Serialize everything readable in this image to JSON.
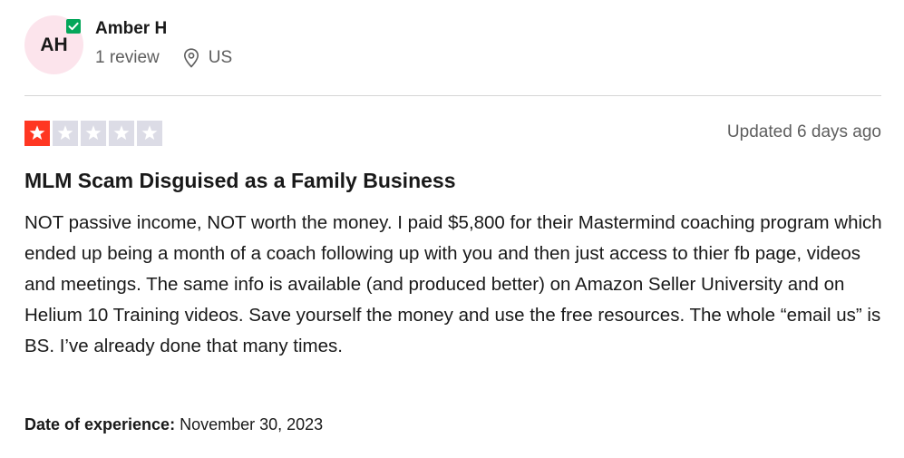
{
  "reviewer": {
    "initials": "AH",
    "name": "Amber H",
    "review_count": "1 review",
    "country": "US",
    "verified": true
  },
  "review": {
    "rating": 1,
    "max_rating": 5,
    "rating_color": "#ff3722",
    "empty_star_color": "#dcdce6",
    "updated": "Updated 6 days ago",
    "title": "MLM Scam Disguised as a Family Business",
    "body": "NOT passive income, NOT worth the money. I paid $5,800 for their Mastermind coaching program which ended up being a month of a coach following up with you and then just access to thier fb page, videos and meetings. The same info is available (and produced better) on Amazon Seller University and on Helium 10 Training videos. Save yourself the money and use the free resources. The whole “email us” is BS. I’ve already done that many times.",
    "experience_label": "Date of experience:",
    "experience_date": "November 30, 2023"
  },
  "colors": {
    "avatar_bg": "#fce4ec",
    "verified": "#04a65a",
    "text": "#191919",
    "muted": "#5e5e5e"
  },
  "icons": {
    "verified": "check-icon",
    "location": "location-pin-icon",
    "star": "star-icon"
  }
}
